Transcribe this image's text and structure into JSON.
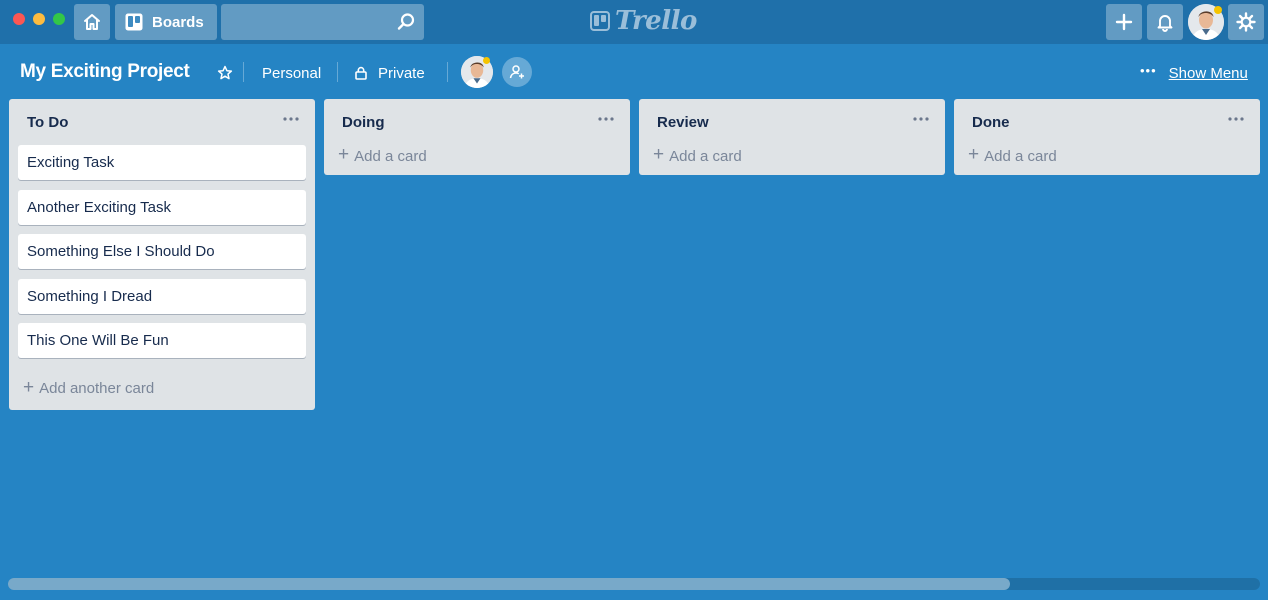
{
  "window": {
    "title": "Trello"
  },
  "topbar": {
    "boards_label": "Boards",
    "search_value": "",
    "logo_text": "Trello"
  },
  "board": {
    "title": "My Exciting Project",
    "visibility_team": "Personal",
    "visibility_privacy": "Private",
    "show_menu_label": "Show Menu"
  },
  "lists": [
    {
      "title": "To Do",
      "cards": [
        "Exciting Task",
        "Another Exciting Task",
        "Something Else I Should Do",
        "Something I Dread",
        "This One Will Be Fun"
      ],
      "add_label": "Add another card"
    },
    {
      "title": "Doing",
      "cards": [],
      "add_label": "Add a card"
    },
    {
      "title": "Review",
      "cards": [],
      "add_label": "Add a card"
    },
    {
      "title": "Done",
      "cards": [],
      "add_label": "Add a card"
    }
  ],
  "scrollbar": {
    "visible_fraction": 0.8
  },
  "colors": {
    "board_bg": "#2584c4",
    "topbar_bg": "#1f70aa",
    "list_bg": "#dfe3e6",
    "notification": "#f5c400"
  },
  "icons": {
    "home": "home-icon",
    "boards": "boards-icon",
    "search": "search-icon",
    "add": "plus-icon",
    "notifications": "bell-icon",
    "settings": "gear-icon",
    "star": "star-icon",
    "lock": "lock-icon",
    "invite": "add-member-icon",
    "list_menu": "more-icon"
  }
}
